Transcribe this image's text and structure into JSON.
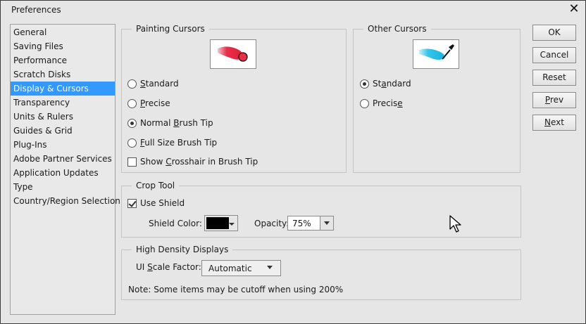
{
  "window": {
    "title": "Preferences",
    "close_symbol": "✕"
  },
  "sidebar": {
    "items": [
      {
        "label": "General"
      },
      {
        "label": "Saving Files"
      },
      {
        "label": "Performance"
      },
      {
        "label": "Scratch Disks"
      },
      {
        "label": "Display & Cursors",
        "selected": true
      },
      {
        "label": "Transparency"
      },
      {
        "label": "Units & Rulers"
      },
      {
        "label": "Guides & Grid"
      },
      {
        "label": "Plug-Ins"
      },
      {
        "label": "Adobe Partner Services"
      },
      {
        "label": "Application Updates"
      },
      {
        "label": "Type"
      },
      {
        "label": "Country/Region Selection"
      }
    ]
  },
  "painting_cursors": {
    "legend": "Painting Cursors",
    "options": {
      "standard": {
        "pre": "",
        "key": "S",
        "post": "tandard",
        "checked": false
      },
      "precise": {
        "pre": "",
        "key": "P",
        "post": "recise",
        "checked": false
      },
      "normal": {
        "pre": "Normal ",
        "key": "B",
        "post": "rush Tip",
        "checked": true
      },
      "full": {
        "pre": "",
        "key": "F",
        "post": "ull Size Brush Tip",
        "checked": false
      }
    },
    "crosshair": {
      "pre": "Show ",
      "key": "C",
      "post": "rosshair in Brush Tip",
      "checked": false
    }
  },
  "other_cursors": {
    "legend": "Other Cursors",
    "options": {
      "standard": {
        "pre": "St",
        "key": "a",
        "post": "ndard",
        "checked": true
      },
      "precise": {
        "pre": "Precis",
        "key": "e",
        "post": "",
        "checked": false
      }
    }
  },
  "crop_tool": {
    "legend": "Crop Tool",
    "use_shield": {
      "label": "Use Shield",
      "checked": true
    },
    "shield_color_label": "Shield Color:",
    "shield_color": "#000000",
    "opacity_label": "Opacity:",
    "opacity_value": "75%"
  },
  "high_density": {
    "legend": "High Density Displays",
    "scale_label_pre": "UI ",
    "scale_label_key": "S",
    "scale_label_post": "cale Factor:",
    "scale_value": "Automatic",
    "note": "Note: Some items may be cutoff when using 200%"
  },
  "buttons": {
    "ok": {
      "pre": "",
      "key": "",
      "post": "OK"
    },
    "cancel": {
      "pre": "",
      "key": "",
      "post": "Cancel"
    },
    "reset": {
      "pre": "",
      "key": "",
      "post": "Reset"
    },
    "prev": {
      "pre": "",
      "key": "P",
      "post": "rev"
    },
    "next": {
      "pre": "",
      "key": "N",
      "post": "ext"
    }
  },
  "icons": {
    "painting_preview": "red-brush-stroke-icon",
    "other_preview": "eyedropper-cyan-stroke-icon",
    "mouse": "arrow-cursor-icon"
  }
}
